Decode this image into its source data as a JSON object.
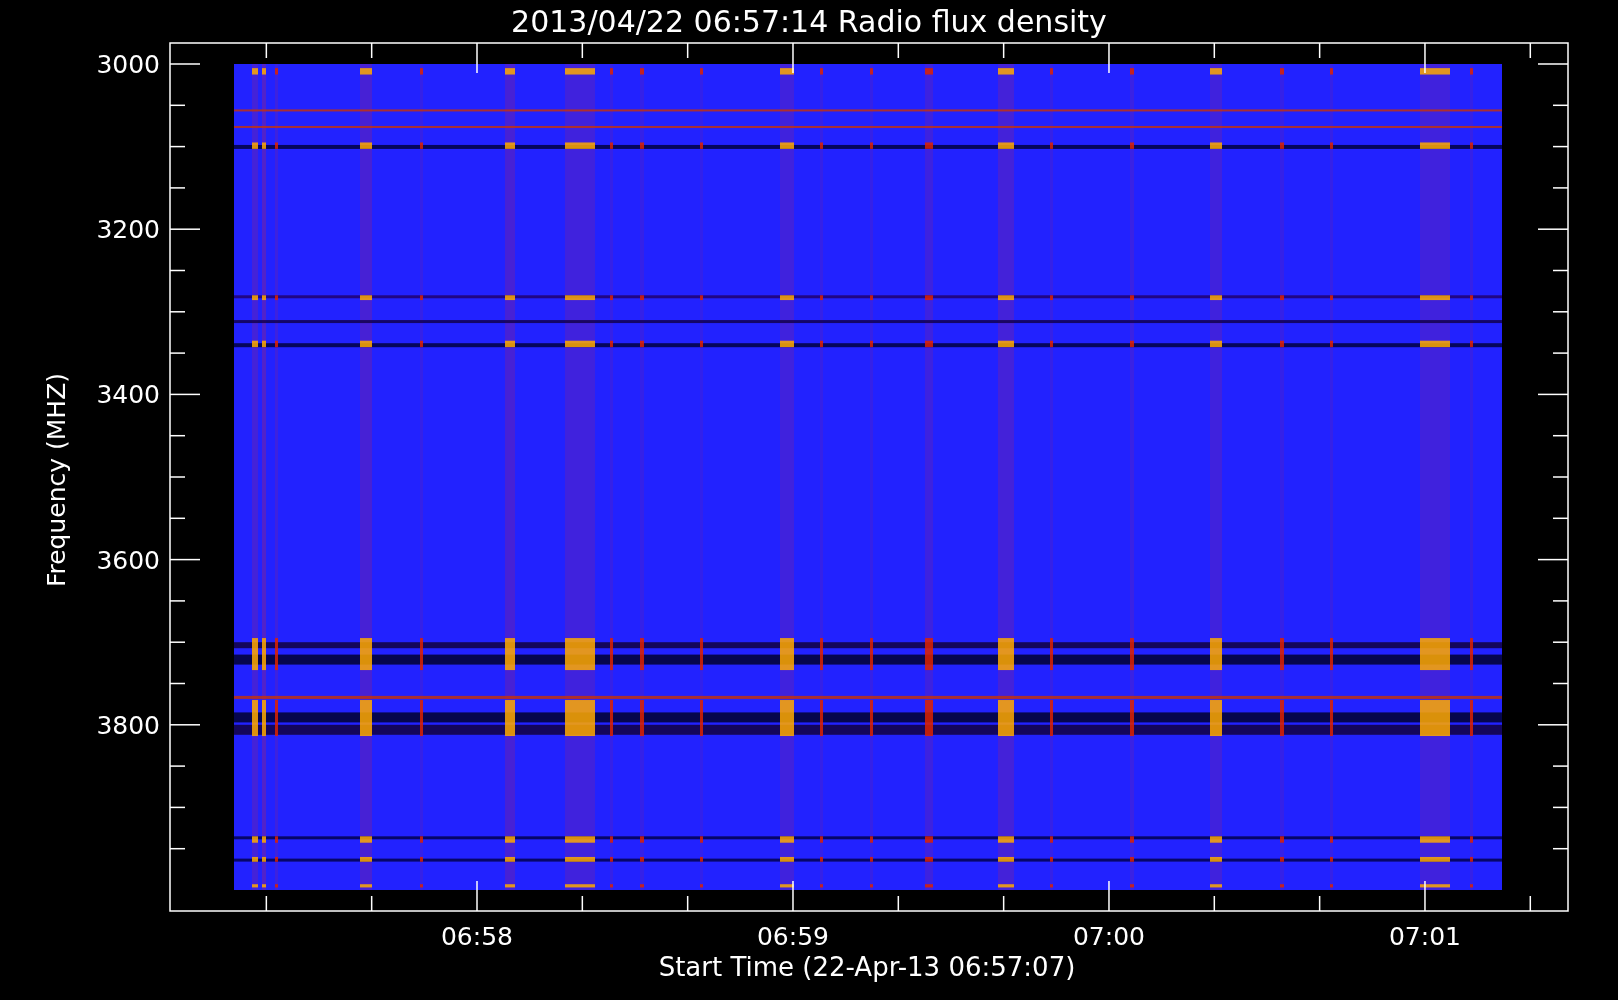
{
  "title": "2013/04/22 06:57:14 Radio flux density",
  "ylabel": "Frequency (MHZ)",
  "xlabel": "Start Time (22-Apr-13 06:57:07)",
  "yticks": [
    "3000",
    "3200",
    "3400",
    "3600",
    "3800"
  ],
  "xticks": [
    "06:58",
    "06:59",
    "07:00",
    "07:01"
  ]
}
